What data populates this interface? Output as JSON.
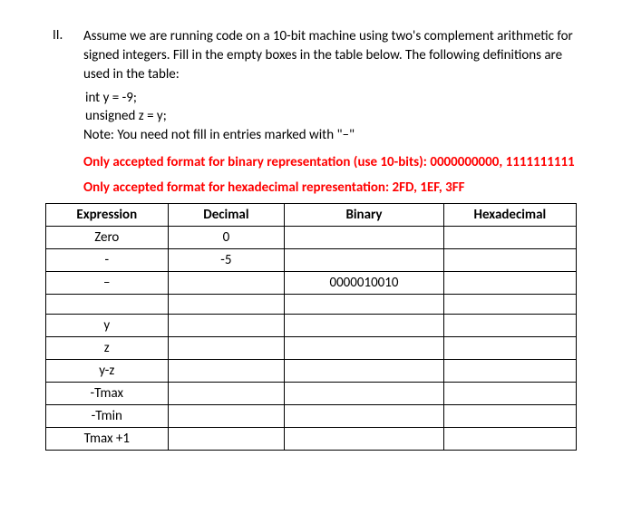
{
  "question": {
    "number": "II.",
    "text1": "Assume we are running code on a 10-bit machine using two's complement arithmetic for signed integers. Fill in the empty boxes in the table below. The following definitions are used in the table:",
    "code1": " int y = -9;",
    "code2": "unsigned z = y;",
    "note": "Note: You need not fill in entries marked with \"–\"",
    "red1": "Only accepted format for binary representation (use 10-bits): 0000000000, 1111111111",
    "red2": "Only accepted format for hexadecimal representation: 2FD, 1EF, 3FF"
  },
  "table": {
    "headers": {
      "expression": "Expression",
      "decimal": "Decimal",
      "binary": "Binary",
      "hex": "Hexadecimal"
    },
    "rows": [
      {
        "expression": "Zero",
        "decimal": "0",
        "binary": "",
        "hex": ""
      },
      {
        "expression": "-",
        "decimal": "-5",
        "binary": "",
        "hex": ""
      },
      {
        "expression": "–",
        "decimal": "",
        "binary": "0000010010",
        "hex": ""
      },
      {
        "expression": "",
        "decimal": "",
        "binary": "",
        "hex": ""
      },
      {
        "expression": "y",
        "decimal": "",
        "binary": "",
        "hex": ""
      },
      {
        "expression": "z",
        "decimal": "",
        "binary": "",
        "hex": ""
      },
      {
        "expression": "y-z",
        "decimal": "",
        "binary": "",
        "hex": ""
      },
      {
        "expression": "-Tmax",
        "decimal": "",
        "binary": "",
        "hex": ""
      },
      {
        "expression": "-Tmin",
        "decimal": "",
        "binary": "",
        "hex": ""
      },
      {
        "expression": "Tmax +1",
        "decimal": "",
        "binary": "",
        "hex": ""
      }
    ]
  }
}
